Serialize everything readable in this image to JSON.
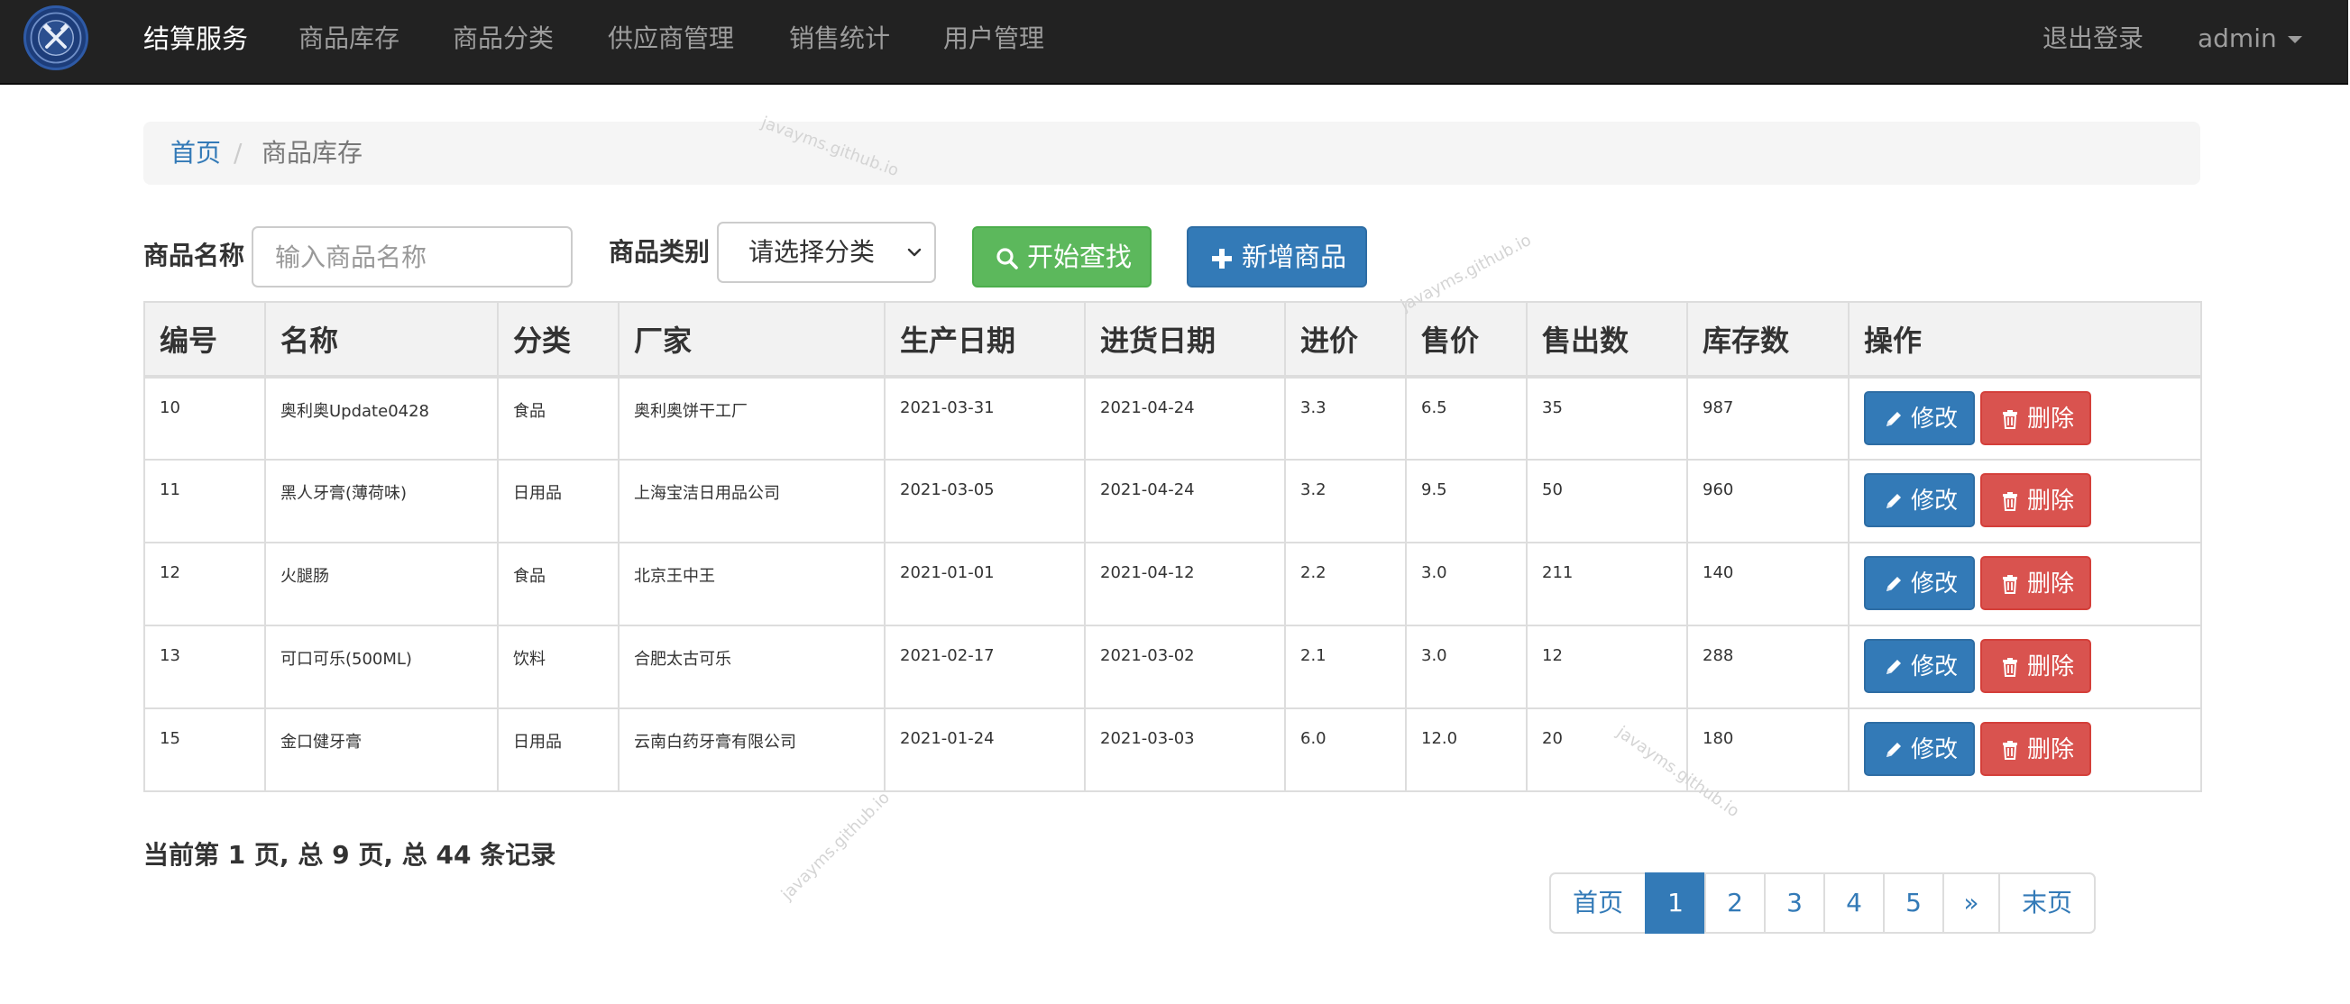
{
  "nav": {
    "brand": "结算服务",
    "items": [
      "商品库存",
      "商品分类",
      "供应商管理",
      "销售统计",
      "用户管理"
    ],
    "logout": "退出登录",
    "user": "admin"
  },
  "breadcrumb": {
    "home": "首页",
    "separator": "/",
    "current": "商品库存"
  },
  "search": {
    "name_label": "商品名称",
    "name_placeholder": "输入商品名称",
    "category_label": "商品类别",
    "category_selected": "请选择分类",
    "search_button": "开始查找",
    "add_button": "新增商品"
  },
  "table": {
    "headers": [
      "编号",
      "名称",
      "分类",
      "厂家",
      "生产日期",
      "进货日期",
      "进价",
      "售价",
      "售出数",
      "库存数",
      "操作"
    ],
    "rows": [
      [
        "10",
        "奥利奥Update0428",
        "食品",
        "奥利奥饼干工厂",
        "2021-03-31",
        "2021-04-24",
        "3.3",
        "6.5",
        "35",
        "987"
      ],
      [
        "11",
        "黑人牙膏(薄荷味)",
        "日用品",
        "上海宝洁日用品公司",
        "2021-03-05",
        "2021-04-24",
        "3.2",
        "9.5",
        "50",
        "960"
      ],
      [
        "12",
        "火腿肠",
        "食品",
        "北京王中王",
        "2021-01-01",
        "2021-04-12",
        "2.2",
        "3.0",
        "211",
        "140"
      ],
      [
        "13",
        "可口可乐(500ML)",
        "饮料",
        "合肥太古可乐",
        "2021-02-17",
        "2021-03-02",
        "2.1",
        "3.0",
        "12",
        "288"
      ],
      [
        "15",
        "金口健牙膏",
        "日用品",
        "云南白药牙膏有限公司",
        "2021-01-24",
        "2021-03-03",
        "6.0",
        "12.0",
        "20",
        "180"
      ]
    ],
    "edit_label": "修改",
    "delete_label": "删除"
  },
  "summary": "当前第 1 页, 总 9 页, 总 44 条记录",
  "pagination": {
    "first": "首页",
    "pages": [
      "1",
      "2",
      "3",
      "4",
      "5"
    ],
    "active_page": "1",
    "next": "»",
    "last": "末页"
  },
  "watermark": "javayms.github.io",
  "colors": {
    "navbar": "#222222",
    "primary": "#337ab7",
    "success": "#5cb85c",
    "danger": "#d9534f",
    "table_header": "#f2f2f2",
    "breadcrumb_bg": "#f5f5f5"
  },
  "icons": {
    "logo": "logo-emblem",
    "search_button": "search-icon",
    "add_button": "plus-icon",
    "edit": "pencil-icon",
    "delete": "trash-icon",
    "user_menu": "caret-down-icon",
    "select": "chevron-down-icon"
  }
}
